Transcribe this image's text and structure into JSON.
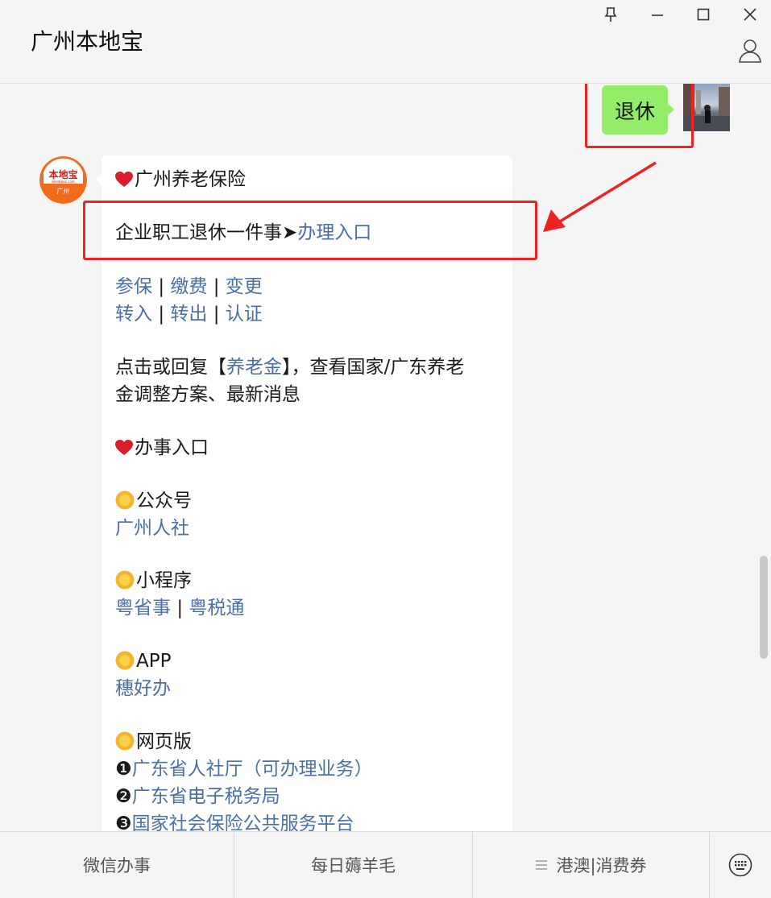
{
  "window": {
    "title": "广州本地宝"
  },
  "sent_message": {
    "text": "退休"
  },
  "reply": {
    "line1_title": "广州养老保险",
    "line2_prefix": "企业职工退休一件事➤",
    "line2_link": "办理入口",
    "row1": [
      "参保",
      "缴费",
      "变更"
    ],
    "row2": [
      "转入",
      "转出",
      "认证"
    ],
    "separator": "|",
    "para_a1": "点击或回复【",
    "para_link": "养老金",
    "para_a2": "】，查看国家/广东养老",
    "para_b": "金调整方案、最新消息",
    "entrance_title": "办事入口",
    "gzh_title": "公众号",
    "gzh_link": "广州人社",
    "mini_title": "小程序",
    "mini_links": [
      "粤省事",
      "粤税通"
    ],
    "app_title": "APP",
    "app_link": "穗好办",
    "web_title": "网页版",
    "web_items": [
      {
        "num": "❶",
        "link": "广东省人社厅",
        "suffix": "（可办理业务）"
      },
      {
        "num": "❷",
        "link": "广东省电子税务局",
        "suffix": ""
      },
      {
        "num": "❸",
        "link": "国家社会保险公共服务平台",
        "suffix": ""
      }
    ]
  },
  "bottom_menu": [
    "微信办事",
    "每日薅羊毛",
    "港澳|消费券"
  ],
  "colors": {
    "bubble_green": "#95ec69",
    "link": "#4a6fa5",
    "highlight_red": "#ee2222",
    "logo_orange": "#f26b1d"
  }
}
